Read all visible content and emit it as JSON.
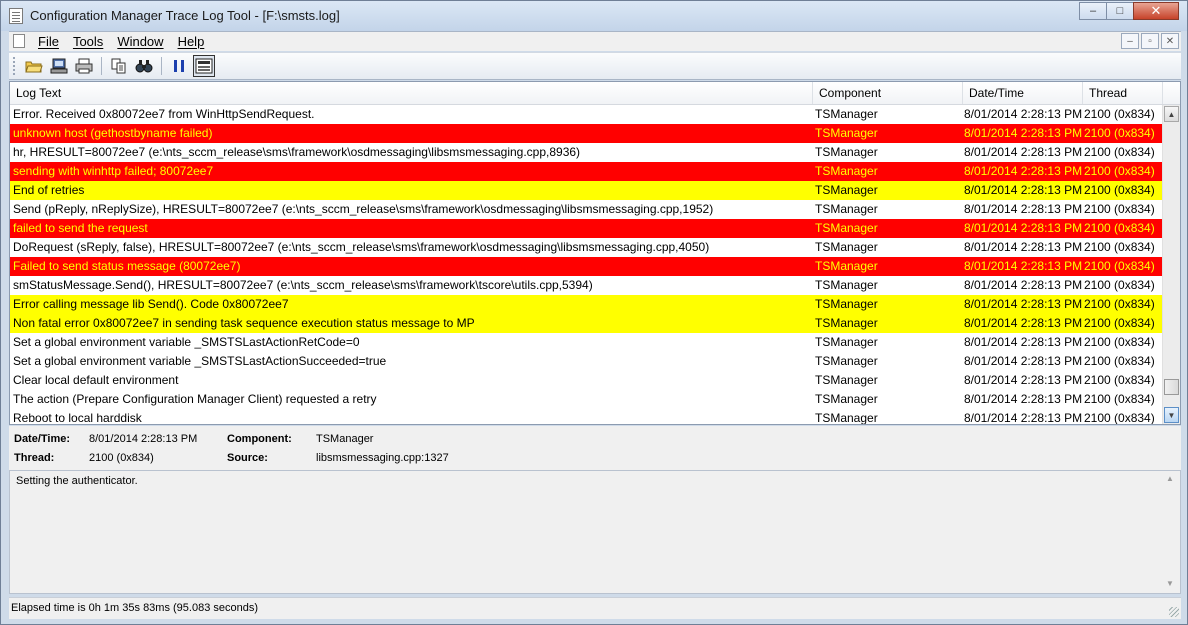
{
  "window": {
    "title": "Configuration Manager Trace Log Tool - [F:\\smsts.log]",
    "buttons": {
      "minimize": "–",
      "maximize": "□",
      "close": "✕"
    }
  },
  "menu": {
    "items": [
      {
        "label": "File"
      },
      {
        "label": "Tools"
      },
      {
        "label": "Window"
      },
      {
        "label": "Help"
      }
    ],
    "mdi_buttons": {
      "minimize": "–",
      "restore": "▫",
      "close": "✕"
    }
  },
  "toolbar": {
    "icons": [
      "open-folder-icon",
      "open-remote-icon",
      "print-icon",
      "copy-icon",
      "find-icon",
      "pause-icon",
      "highlight-icon"
    ]
  },
  "list": {
    "columns": {
      "text": "Log Text",
      "component": "Component",
      "datetime": "Date/Time",
      "thread": "Thread"
    },
    "colors": {
      "error_bg": "#ff0000",
      "error_fg": "#ffff00",
      "warning_bg": "#ffff00"
    },
    "rows": [
      {
        "text": "Error. Received 0x80072ee7 from WinHttpSendRequest.",
        "component": "TSManager",
        "datetime": "8/01/2014 2:28:13 PM",
        "thread": "2100 (0x834)",
        "level": "normal"
      },
      {
        "text": "unknown host (gethostbyname failed)",
        "component": "TSManager",
        "datetime": "8/01/2014 2:28:13 PM",
        "thread": "2100 (0x834)",
        "level": "error"
      },
      {
        "text": "hr, HRESULT=80072ee7 (e:\\nts_sccm_release\\sms\\framework\\osdmessaging\\libsmsmessaging.cpp,8936)",
        "component": "TSManager",
        "datetime": "8/01/2014 2:28:13 PM",
        "thread": "2100 (0x834)",
        "level": "normal"
      },
      {
        "text": "sending with winhttp failed; 80072ee7",
        "component": "TSManager",
        "datetime": "8/01/2014 2:28:13 PM",
        "thread": "2100 (0x834)",
        "level": "error"
      },
      {
        "text": "End of retries",
        "component": "TSManager",
        "datetime": "8/01/2014 2:28:13 PM",
        "thread": "2100 (0x834)",
        "level": "warning"
      },
      {
        "text": "Send (pReply, nReplySize), HRESULT=80072ee7 (e:\\nts_sccm_release\\sms\\framework\\osdmessaging\\libsmsmessaging.cpp,1952)",
        "component": "TSManager",
        "datetime": "8/01/2014 2:28:13 PM",
        "thread": "2100 (0x834)",
        "level": "normal"
      },
      {
        "text": "failed to send the request",
        "component": "TSManager",
        "datetime": "8/01/2014 2:28:13 PM",
        "thread": "2100 (0x834)",
        "level": "error"
      },
      {
        "text": "DoRequest (sReply, false), HRESULT=80072ee7 (e:\\nts_sccm_release\\sms\\framework\\osdmessaging\\libsmsmessaging.cpp,4050)",
        "component": "TSManager",
        "datetime": "8/01/2014 2:28:13 PM",
        "thread": "2100 (0x834)",
        "level": "normal"
      },
      {
        "text": "Failed to send status message (80072ee7)",
        "component": "TSManager",
        "datetime": "8/01/2014 2:28:13 PM",
        "thread": "2100 (0x834)",
        "level": "error"
      },
      {
        "text": "smStatusMessage.Send(), HRESULT=80072ee7 (e:\\nts_sccm_release\\sms\\framework\\tscore\\utils.cpp,5394)",
        "component": "TSManager",
        "datetime": "8/01/2014 2:28:13 PM",
        "thread": "2100 (0x834)",
        "level": "normal"
      },
      {
        "text": "Error calling message lib Send(). Code 0x80072ee7",
        "component": "TSManager",
        "datetime": "8/01/2014 2:28:13 PM",
        "thread": "2100 (0x834)",
        "level": "warning"
      },
      {
        "text": "Non fatal error 0x80072ee7 in sending task sequence execution status message to MP",
        "component": "TSManager",
        "datetime": "8/01/2014 2:28:13 PM",
        "thread": "2100 (0x834)",
        "level": "warning"
      },
      {
        "text": "Set a global environment variable _SMSTSLastActionRetCode=0",
        "component": "TSManager",
        "datetime": "8/01/2014 2:28:13 PM",
        "thread": "2100 (0x834)",
        "level": "normal"
      },
      {
        "text": "Set a global environment variable _SMSTSLastActionSucceeded=true",
        "component": "TSManager",
        "datetime": "8/01/2014 2:28:13 PM",
        "thread": "2100 (0x834)",
        "level": "normal"
      },
      {
        "text": "Clear local default environment",
        "component": "TSManager",
        "datetime": "8/01/2014 2:28:13 PM",
        "thread": "2100 (0x834)",
        "level": "normal"
      },
      {
        "text": "The action (Prepare Configuration Manager Client) requested a retry",
        "component": "TSManager",
        "datetime": "8/01/2014 2:28:13 PM",
        "thread": "2100 (0x834)",
        "level": "normal"
      },
      {
        "text": "Reboot to local harddisk",
        "component": "TSManager",
        "datetime": "8/01/2014 2:28:13 PM",
        "thread": "2100 (0x834)",
        "level": "normal"
      }
    ]
  },
  "details": {
    "datetime_label": "Date/Time:",
    "datetime_value": "8/01/2014 2:28:13 PM",
    "component_label": "Component:",
    "component_value": "TSManager",
    "thread_label": "Thread:",
    "thread_value": "2100 (0x834)",
    "source_label": "Source:",
    "source_value": "libsmsmessaging.cpp:1327"
  },
  "description": {
    "text": "Setting the authenticator."
  },
  "status": {
    "text": "Elapsed time is 0h 1m 35s 83ms (95.083 seconds)"
  }
}
